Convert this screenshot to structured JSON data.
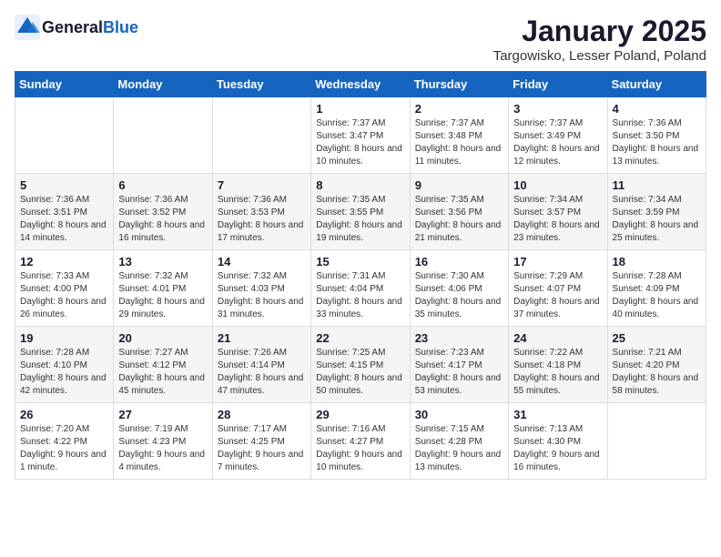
{
  "logo": {
    "text_general": "General",
    "text_blue": "Blue"
  },
  "header": {
    "month_title": "January 2025",
    "location": "Targowisko, Lesser Poland, Poland"
  },
  "weekdays": [
    "Sunday",
    "Monday",
    "Tuesday",
    "Wednesday",
    "Thursday",
    "Friday",
    "Saturday"
  ],
  "weeks": [
    [
      {
        "day": "",
        "sunrise": "",
        "sunset": "",
        "daylight": ""
      },
      {
        "day": "",
        "sunrise": "",
        "sunset": "",
        "daylight": ""
      },
      {
        "day": "",
        "sunrise": "",
        "sunset": "",
        "daylight": ""
      },
      {
        "day": "1",
        "sunrise": "Sunrise: 7:37 AM",
        "sunset": "Sunset: 3:47 PM",
        "daylight": "Daylight: 8 hours and 10 minutes."
      },
      {
        "day": "2",
        "sunrise": "Sunrise: 7:37 AM",
        "sunset": "Sunset: 3:48 PM",
        "daylight": "Daylight: 8 hours and 11 minutes."
      },
      {
        "day": "3",
        "sunrise": "Sunrise: 7:37 AM",
        "sunset": "Sunset: 3:49 PM",
        "daylight": "Daylight: 8 hours and 12 minutes."
      },
      {
        "day": "4",
        "sunrise": "Sunrise: 7:36 AM",
        "sunset": "Sunset: 3:50 PM",
        "daylight": "Daylight: 8 hours and 13 minutes."
      }
    ],
    [
      {
        "day": "5",
        "sunrise": "Sunrise: 7:36 AM",
        "sunset": "Sunset: 3:51 PM",
        "daylight": "Daylight: 8 hours and 14 minutes."
      },
      {
        "day": "6",
        "sunrise": "Sunrise: 7:36 AM",
        "sunset": "Sunset: 3:52 PM",
        "daylight": "Daylight: 8 hours and 16 minutes."
      },
      {
        "day": "7",
        "sunrise": "Sunrise: 7:36 AM",
        "sunset": "Sunset: 3:53 PM",
        "daylight": "Daylight: 8 hours and 17 minutes."
      },
      {
        "day": "8",
        "sunrise": "Sunrise: 7:35 AM",
        "sunset": "Sunset: 3:55 PM",
        "daylight": "Daylight: 8 hours and 19 minutes."
      },
      {
        "day": "9",
        "sunrise": "Sunrise: 7:35 AM",
        "sunset": "Sunset: 3:56 PM",
        "daylight": "Daylight: 8 hours and 21 minutes."
      },
      {
        "day": "10",
        "sunrise": "Sunrise: 7:34 AM",
        "sunset": "Sunset: 3:57 PM",
        "daylight": "Daylight: 8 hours and 23 minutes."
      },
      {
        "day": "11",
        "sunrise": "Sunrise: 7:34 AM",
        "sunset": "Sunset: 3:59 PM",
        "daylight": "Daylight: 8 hours and 25 minutes."
      }
    ],
    [
      {
        "day": "12",
        "sunrise": "Sunrise: 7:33 AM",
        "sunset": "Sunset: 4:00 PM",
        "daylight": "Daylight: 8 hours and 26 minutes."
      },
      {
        "day": "13",
        "sunrise": "Sunrise: 7:32 AM",
        "sunset": "Sunset: 4:01 PM",
        "daylight": "Daylight: 8 hours and 29 minutes."
      },
      {
        "day": "14",
        "sunrise": "Sunrise: 7:32 AM",
        "sunset": "Sunset: 4:03 PM",
        "daylight": "Daylight: 8 hours and 31 minutes."
      },
      {
        "day": "15",
        "sunrise": "Sunrise: 7:31 AM",
        "sunset": "Sunset: 4:04 PM",
        "daylight": "Daylight: 8 hours and 33 minutes."
      },
      {
        "day": "16",
        "sunrise": "Sunrise: 7:30 AM",
        "sunset": "Sunset: 4:06 PM",
        "daylight": "Daylight: 8 hours and 35 minutes."
      },
      {
        "day": "17",
        "sunrise": "Sunrise: 7:29 AM",
        "sunset": "Sunset: 4:07 PM",
        "daylight": "Daylight: 8 hours and 37 minutes."
      },
      {
        "day": "18",
        "sunrise": "Sunrise: 7:28 AM",
        "sunset": "Sunset: 4:09 PM",
        "daylight": "Daylight: 8 hours and 40 minutes."
      }
    ],
    [
      {
        "day": "19",
        "sunrise": "Sunrise: 7:28 AM",
        "sunset": "Sunset: 4:10 PM",
        "daylight": "Daylight: 8 hours and 42 minutes."
      },
      {
        "day": "20",
        "sunrise": "Sunrise: 7:27 AM",
        "sunset": "Sunset: 4:12 PM",
        "daylight": "Daylight: 8 hours and 45 minutes."
      },
      {
        "day": "21",
        "sunrise": "Sunrise: 7:26 AM",
        "sunset": "Sunset: 4:14 PM",
        "daylight": "Daylight: 8 hours and 47 minutes."
      },
      {
        "day": "22",
        "sunrise": "Sunrise: 7:25 AM",
        "sunset": "Sunset: 4:15 PM",
        "daylight": "Daylight: 8 hours and 50 minutes."
      },
      {
        "day": "23",
        "sunrise": "Sunrise: 7:23 AM",
        "sunset": "Sunset: 4:17 PM",
        "daylight": "Daylight: 8 hours and 53 minutes."
      },
      {
        "day": "24",
        "sunrise": "Sunrise: 7:22 AM",
        "sunset": "Sunset: 4:18 PM",
        "daylight": "Daylight: 8 hours and 55 minutes."
      },
      {
        "day": "25",
        "sunrise": "Sunrise: 7:21 AM",
        "sunset": "Sunset: 4:20 PM",
        "daylight": "Daylight: 8 hours and 58 minutes."
      }
    ],
    [
      {
        "day": "26",
        "sunrise": "Sunrise: 7:20 AM",
        "sunset": "Sunset: 4:22 PM",
        "daylight": "Daylight: 9 hours and 1 minute."
      },
      {
        "day": "27",
        "sunrise": "Sunrise: 7:19 AM",
        "sunset": "Sunset: 4:23 PM",
        "daylight": "Daylight: 9 hours and 4 minutes."
      },
      {
        "day": "28",
        "sunrise": "Sunrise: 7:17 AM",
        "sunset": "Sunset: 4:25 PM",
        "daylight": "Daylight: 9 hours and 7 minutes."
      },
      {
        "day": "29",
        "sunrise": "Sunrise: 7:16 AM",
        "sunset": "Sunset: 4:27 PM",
        "daylight": "Daylight: 9 hours and 10 minutes."
      },
      {
        "day": "30",
        "sunrise": "Sunrise: 7:15 AM",
        "sunset": "Sunset: 4:28 PM",
        "daylight": "Daylight: 9 hours and 13 minutes."
      },
      {
        "day": "31",
        "sunrise": "Sunrise: 7:13 AM",
        "sunset": "Sunset: 4:30 PM",
        "daylight": "Daylight: 9 hours and 16 minutes."
      },
      {
        "day": "",
        "sunrise": "",
        "sunset": "",
        "daylight": ""
      }
    ]
  ]
}
